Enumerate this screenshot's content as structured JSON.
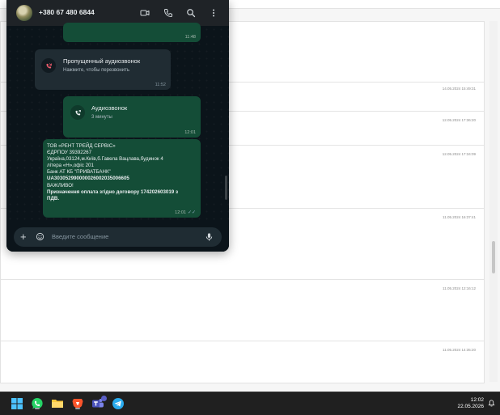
{
  "header": {
    "contact_name": "+380 67 480 6844",
    "icons": [
      "video-call-icon",
      "phone-icon",
      "search-icon",
      "menu-dots-icon"
    ]
  },
  "messages": [
    {
      "type": "outgoing",
      "time": "11:48"
    },
    {
      "type": "missed_call",
      "title": "Пропущенный аудиозвонок",
      "subtitle": "Нажмите, чтобы перезвонить",
      "time": "11:52"
    },
    {
      "type": "outgoing_call",
      "title": "Аудиозвонок",
      "subtitle": "3 минуты",
      "time": "12:01"
    },
    {
      "type": "outgoing_text",
      "lines": [
        "ТОВ «РЕНТ ТРЕЙД СЕРВІС»",
        "ЄДРПОУ 39392267",
        "Україна,03124,м.Київ,б.Гавела Вацлава,будинок 4",
        "літера «Н»,офіс 201",
        "Банк АТ КБ \"ПРИВАТБАНК\"",
        "UA303052990000026002035006605",
        "ВАЖЛИВО!",
        " Призначення оплата згідно договору 174202603019 з",
        "ПДВ."
      ],
      "time": "12:01"
    }
  ],
  "composer": {
    "placeholder": "Введите сообщение"
  },
  "background_list": {
    "timestamps": [
      "14.05.2024 15:49:31",
      "12.05.2024 17:36:20",
      "12.05.2024 17:34:09",
      "11.05.2024 16:37:41",
      "11.05.2024 12:16:12",
      "11.05.2024 14:35:20"
    ]
  },
  "taskbar": {
    "apps": [
      "windows-start-icon",
      "whatsapp-icon",
      "file-explorer-icon",
      "brave-browser-icon",
      "teams-icon",
      "telegram-icon"
    ],
    "time": "12:02",
    "date": "22.05.2026"
  },
  "colors": {
    "chat_bg": "#0b141a",
    "header_bg": "#1f2327",
    "outgoing_bubble": "#144d37",
    "incoming_bubble": "#202c33",
    "missed_call_red": "#f15c6d",
    "taskbar_bg": "#202020"
  }
}
